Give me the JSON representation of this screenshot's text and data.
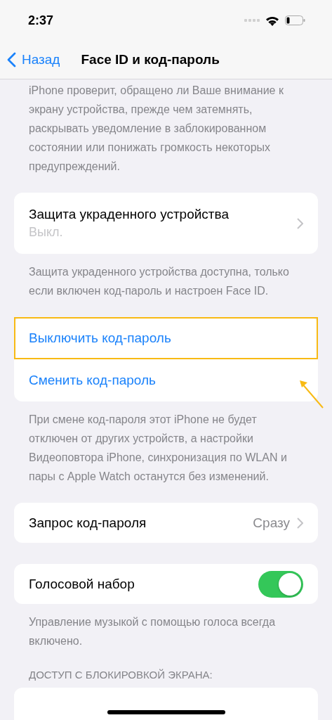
{
  "status_bar": {
    "time": "2:37"
  },
  "nav": {
    "back": "Назад",
    "title": "Face ID и код-пароль"
  },
  "sections": [
    {
      "kind": "note",
      "text": "iPhone проверит, обращено ли Ваше внимание к экрану устройства, прежде чем затемнять, раскрывать уведомление в заблокированном состоянии или понижать громкость некоторых предупреждений."
    },
    {
      "kind": "group",
      "rows": [
        {
          "kind": "detail",
          "label": "Защита украденного устройства",
          "subtitle": "Выкл."
        }
      ]
    },
    {
      "kind": "note",
      "text": "Защита украденного устройства доступна, только если включен код-пароль и настроен Face ID."
    },
    {
      "kind": "group",
      "rows": [
        {
          "kind": "action",
          "label": "Выключить код-пароль",
          "highlighted": true
        },
        {
          "kind": "action",
          "label": "Сменить код-пароль",
          "highlighted": false
        }
      ]
    },
    {
      "kind": "note",
      "text": "При смене код-пароля этот iPhone не будет отключен от других устройств, а настройки Видеоповтора iPhone, синхронизация по WLAN и пары с Apple Watch останутся без изменений."
    },
    {
      "kind": "group",
      "rows": [
        {
          "kind": "value",
          "label": "Запрос код-пароля",
          "value": "Сразу"
        }
      ]
    },
    {
      "kind": "group",
      "rows": [
        {
          "kind": "toggle",
          "label": "Голосовой набор",
          "on": true
        }
      ]
    },
    {
      "kind": "note",
      "text": "Управление музыкой с помощью голоса всегда включено."
    },
    {
      "kind": "header",
      "text": "ДОСТУП С БЛОКИРОВКОЙ ЭКРАНА:"
    },
    {
      "kind": "group"
    }
  ]
}
